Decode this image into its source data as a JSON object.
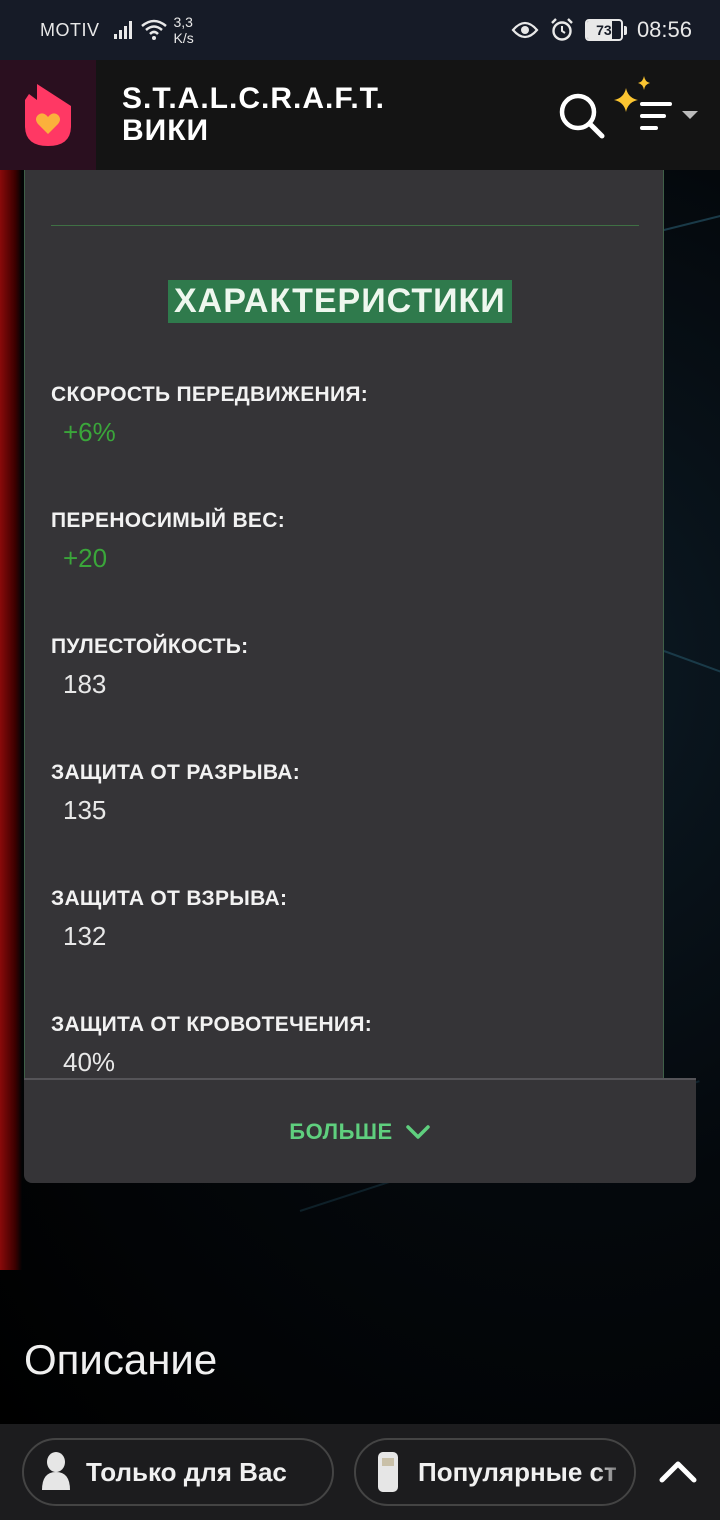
{
  "status_bar": {
    "carrier": "MOTIV",
    "speed_value": "3,3",
    "speed_unit": "K/s",
    "battery": "73",
    "time": "08:56"
  },
  "header": {
    "title_line1": "S.T.A.L.C.R.A.F.T.",
    "title_line2": "ВИКИ"
  },
  "card": {
    "heading": "ХАРАКТЕРИСТИКИ",
    "stats": [
      {
        "label": "СКОРОСТЬ ПЕРЕДВИЖЕНИЯ:",
        "value": "+6%"
      },
      {
        "label": "ПЕРЕНОСИМЫЙ ВЕС:",
        "value": "+20"
      },
      {
        "label": "ПУЛЕСТОЙКОСТЬ:",
        "value": "183"
      },
      {
        "label": "ЗАЩИТА ОТ РАЗРЫВА:",
        "value": "135"
      },
      {
        "label": "ЗАЩИТА ОТ ВЗРЫВА:",
        "value": "132"
      },
      {
        "label": "ЗАЩИТА ОТ КРОВОТЕЧЕНИЯ:",
        "value": "40%"
      }
    ],
    "more_label": "БОЛЬШЕ"
  },
  "section_title": "Описание",
  "bottom_bar": {
    "pill_1": "Только для Вас",
    "pill_2": "Популярные ст"
  },
  "colors": {
    "accent_green": "#2f7a4c",
    "stat_positive": "#3aa63a",
    "more_link": "#5fcf7e",
    "logo": "#ff3864"
  }
}
